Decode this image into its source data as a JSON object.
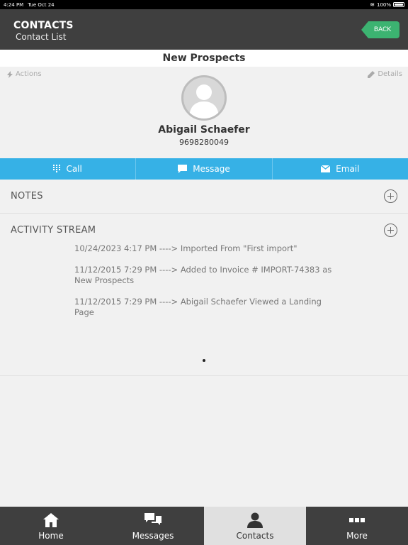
{
  "status": {
    "time": "4:24 PM",
    "date": "Tue Oct 24",
    "battery": "100%"
  },
  "header": {
    "title": "CONTACTS",
    "subtitle": "Contact List",
    "back_label": "BACK"
  },
  "list_title": "New Prospects",
  "links": {
    "actions": "Actions",
    "details": "Details"
  },
  "contact": {
    "name": "Abigail Schaefer",
    "phone": "9698280049"
  },
  "action_bar": {
    "call": "Call",
    "message": "Message",
    "email": "Email"
  },
  "sections": {
    "notes": "NOTES",
    "activity": "ACTIVITY STREAM"
  },
  "activity": [
    {
      "text": "10/24/2023 4:17 PM ----> Imported From \"First import\""
    },
    {
      "text": "11/12/2015 7:29 PM ----> Added to Invoice # IMPORT-74383 as New Prospects"
    },
    {
      "text": "11/12/2015 7:29 PM ----> Abigail Schaefer Viewed a Landing Page"
    }
  ],
  "tabs": {
    "home": "Home",
    "messages": "Messages",
    "contacts": "Contacts",
    "more": "More"
  },
  "colors": {
    "accent_blue": "#36b1e6",
    "back_green": "#3cb371",
    "header_dark": "#3f3f3f"
  }
}
